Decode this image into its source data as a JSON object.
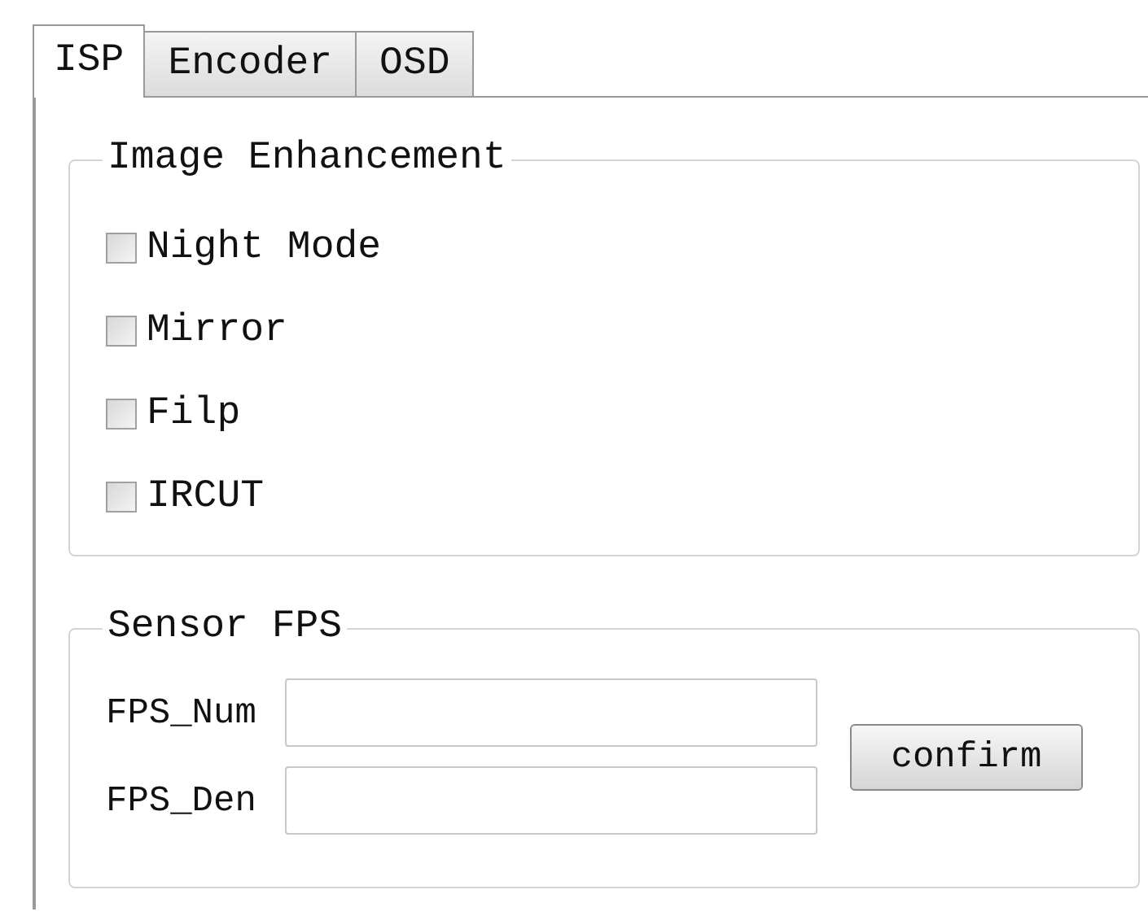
{
  "tabs": [
    {
      "label": "ISP",
      "selected": true
    },
    {
      "label": "Encoder",
      "selected": false
    },
    {
      "label": "OSD",
      "selected": false
    }
  ],
  "image_enhancement": {
    "title": "Image Enhancement",
    "options": [
      {
        "label": "Night Mode",
        "checked": false
      },
      {
        "label": "Mirror",
        "checked": false
      },
      {
        "label": "Filp",
        "checked": false
      },
      {
        "label": "IRCUT",
        "checked": false
      }
    ]
  },
  "sensor_fps": {
    "title": "Sensor FPS",
    "fields": [
      {
        "label": "FPS_Num"
      },
      {
        "label": "FPS_Den"
      }
    ],
    "button": "confirm"
  }
}
